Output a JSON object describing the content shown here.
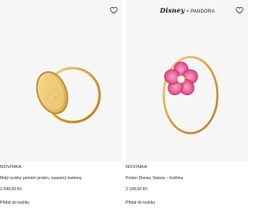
{
  "products": [
    {
      "badge": "NOVINKA",
      "title": "Malý oválný pečetní prsten, osazený kameny",
      "price": "1 649,00 Kč",
      "cta": "Přidat do košíku",
      "wishlist_icon": "heart-outline-icon",
      "brand": null
    },
    {
      "badge": "NOVINKA",
      "title": "Prsten Disney Vaiana – Květina",
      "price": "2 199,00 Kč",
      "cta": "Přidat do košíku",
      "wishlist_icon": "heart-outline-icon",
      "brand": {
        "left": "Disney",
        "separator": "×",
        "right": "PANDORA"
      }
    }
  ],
  "colors": {
    "image_bg": "#f6f6f6",
    "gold": "#d9a53a",
    "pink": "#e2387b"
  }
}
